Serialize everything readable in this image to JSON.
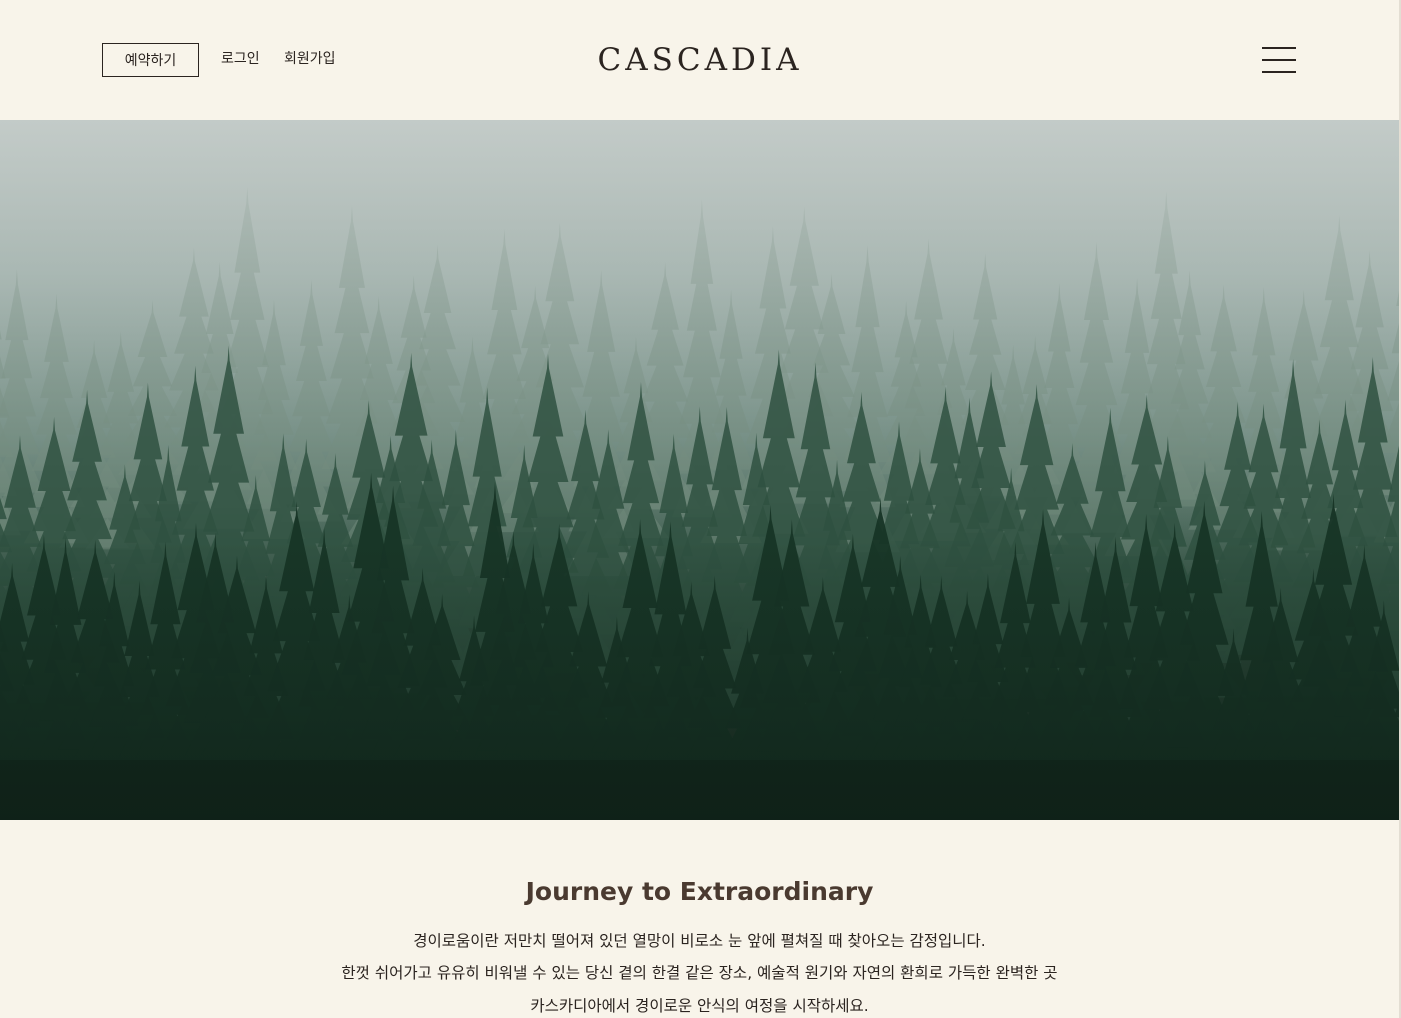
{
  "header": {
    "reserve_label": "예약하기",
    "login_label": "로그인",
    "signup_label": "회원가입",
    "logo_text": "CASCADIA",
    "menu_icon": "hamburger-menu-icon"
  },
  "hero": {
    "image_subject": "misty-forest"
  },
  "intro": {
    "title": "Journey to Extraordinary",
    "lines": [
      "경이로움이란 저만치 떨어져 있던 열망이 비로소 눈 앞에 펼쳐질 때 찾아오는 감정입니다.",
      "한껏 쉬어가고 유유히 비워낼 수 있는 당신 곁의 한결 같은 장소, 예술적 원기와 자연의 환희로 가득한 완벽한 곳",
      "카스카디아에서 경이로운 안식의 여정을 시작하세요."
    ]
  },
  "colors": {
    "background": "#f8f4ea",
    "text": "#2b2420",
    "title": "#4a3a30",
    "forest_dark": "#16291f",
    "fog": "#b9c3c0"
  }
}
